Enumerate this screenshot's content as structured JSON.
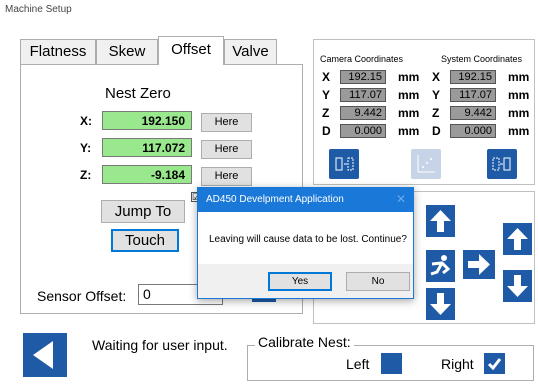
{
  "window": {
    "title": "Machine Setup"
  },
  "tabs": [
    {
      "label": "Flatness",
      "active": false
    },
    {
      "label": "Skew",
      "active": false
    },
    {
      "label": "Offset",
      "active": true
    },
    {
      "label": "Valve",
      "active": false
    }
  ],
  "nest_zero": {
    "title": "Nest Zero",
    "rows": [
      {
        "axis": "X:",
        "value": "192.150",
        "button": "Here"
      },
      {
        "axis": "Y:",
        "value": "117.072",
        "button": "Here"
      },
      {
        "axis": "Z:",
        "value": "-9.184",
        "button": "Here"
      }
    ],
    "jump_to_label": "Jump To",
    "touch_label": "Touch"
  },
  "sensor_offset": {
    "label": "Sensor Offset:",
    "value": "0"
  },
  "coordinates": {
    "camera_header": "Camera Coordinates",
    "system_header": "System Coordinates",
    "rows": [
      {
        "axis": "X",
        "camera": "192.15",
        "system": "192.15",
        "unit": "mm"
      },
      {
        "axis": "Y",
        "camera": "117.07",
        "system": "117.07",
        "unit": "mm"
      },
      {
        "axis": "Z",
        "camera": "9.442",
        "system": "9.442",
        "unit": "mm"
      },
      {
        "axis": "D",
        "camera": "0.000",
        "system": "0.000",
        "unit": "mm"
      }
    ]
  },
  "dialog": {
    "title": "AD450 Develpment Application",
    "message": "Leaving will cause data to be lost. Continue?",
    "yes_label": "Yes",
    "no_label": "No",
    "close_glyph": "✕"
  },
  "status": {
    "text": "Waiting for user input."
  },
  "calibrate": {
    "label": "Calibrate Nest:",
    "left_label": "Left",
    "right_label": "Right",
    "left_checked": false,
    "right_checked": true
  },
  "colors": {
    "accent": "#1f5aa6",
    "value_green": "#9ae88e",
    "dialog_blue": "#1a78d8"
  },
  "icons": [
    "back-arrow-icon",
    "arrow-up-icon",
    "arrow-down-icon",
    "arrow-right-icon",
    "person-icon",
    "camera-to-system-icon",
    "scatter-icon",
    "system-to-camera-icon",
    "checkmark-icon"
  ]
}
